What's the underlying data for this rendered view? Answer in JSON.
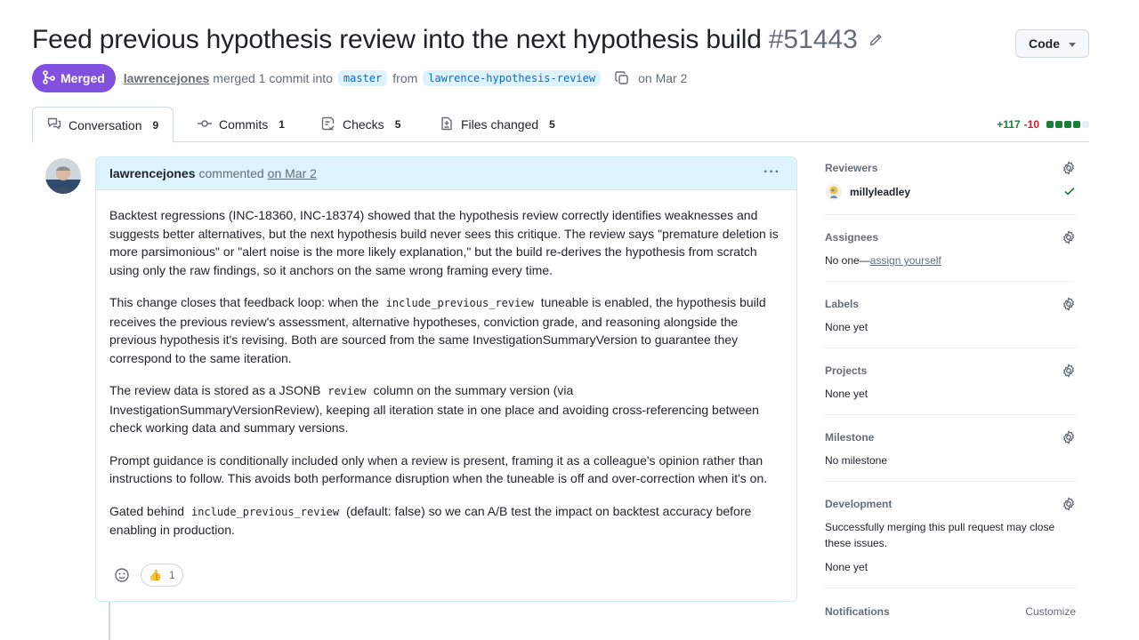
{
  "header": {
    "title": "Feed previous hypothesis review into the next hypothesis build",
    "number": "#51443",
    "code_button": "Code"
  },
  "meta": {
    "status": "Merged",
    "user": "lawrencejones",
    "action": "merged 1 commit into",
    "base_branch": "master",
    "from": "from",
    "head_branch": "lawrence-hypothesis-review",
    "date": "on Mar 2"
  },
  "tabs": [
    {
      "label": "Conversation",
      "count": "9"
    },
    {
      "label": "Commits",
      "count": "1"
    },
    {
      "label": "Checks",
      "count": "5"
    },
    {
      "label": "Files changed",
      "count": "5"
    }
  ],
  "diffstat": {
    "additions": "+117",
    "deletions": "-10"
  },
  "comment": {
    "author": "lawrencejones",
    "action": "commented",
    "date": "on Mar 2",
    "kebab": "···",
    "p1": "Backtest regressions (INC-18360, INC-18374) showed that the hypothesis review correctly identifies weaknesses and suggests better alternatives, but the next hypothesis build never sees this critique. The review says \"premature deletion is more parsimonious\" or \"alert noise is the more likely explanation,\" but the build re-derives the hypothesis from scratch using only the raw findings, so it anchors on the same wrong framing every time.",
    "p2_a": "This change closes that feedback loop: when the",
    "p2_code": "include_previous_review",
    "p2_b": "tuneable is enabled, the hypothesis build receives the previous review's assessment, alternative hypotheses, conviction grade, and reasoning alongside the previous hypothesis it's revising. Both are sourced from the same InvestigationSummaryVersion to guarantee they correspond to the same iteration.",
    "p3_a": "The review data is stored as a JSONB",
    "p3_code": "review",
    "p3_b": "column on the summary version (via InvestigationSummaryVersionReview), keeping all iteration state in one place and avoiding cross-referencing between check working data and summary versions.",
    "p4": "Prompt guidance is conditionally included only when a review is present, framing it as a colleague's opinion rather than instructions to follow. This avoids both performance disruption when the tuneable is off and over-correction when it's on.",
    "p5_a": "Gated behind",
    "p5_code": "include_previous_review",
    "p5_b": "(default: false) so we can A/B test the impact on backtest accuracy before enabling in production.",
    "reaction_emoji": "👍",
    "reaction_count": "1"
  },
  "sidebar": {
    "reviewers": {
      "title": "Reviewers",
      "name": "millyleadley"
    },
    "assignees": {
      "title": "Assignees",
      "none": "No one—",
      "link": "assign yourself"
    },
    "labels": {
      "title": "Labels",
      "value": "None yet"
    },
    "projects": {
      "title": "Projects",
      "value": "None yet"
    },
    "milestone": {
      "title": "Milestone",
      "value": "No milestone"
    },
    "development": {
      "title": "Development",
      "desc": "Successfully merging this pull request may close these issues.",
      "value": "None yet"
    },
    "notifications": {
      "title": "Notifications",
      "action": "Customize"
    }
  },
  "colors": {
    "merged": "#8250df",
    "additions": "#1a7f37",
    "deletions": "#cf222e",
    "link": "#0969da"
  }
}
